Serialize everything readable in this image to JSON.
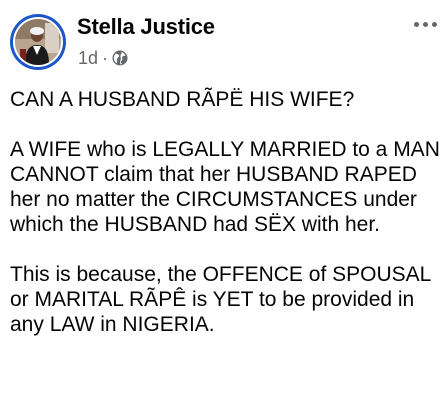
{
  "post": {
    "author": {
      "name": "Stella Justice",
      "avatar_icon": "profile-photo"
    },
    "timestamp": "1d",
    "separator": "·",
    "audience_icon": "globe-icon",
    "more_icon": "more-options-icon",
    "paragraphs": [
      "CAN A HUSBAND RÃPË HIS WIFE?",
      "A WIFE who is LEGALLY MARRIED to a MAN CANNOT claim that her HUSBAND RAPED her no matter the CIRCUMSTANCES under which the HUSBAND had SËX with her.",
      "This is because, the OFFENCE of SPOUSAL or MARITAL RÃPÊ is YET to be provided in any LAW in NIGERIA."
    ]
  },
  "colors": {
    "text_primary": "#050505",
    "text_secondary": "#65676b",
    "avatar_ring": "#1b57c8"
  }
}
